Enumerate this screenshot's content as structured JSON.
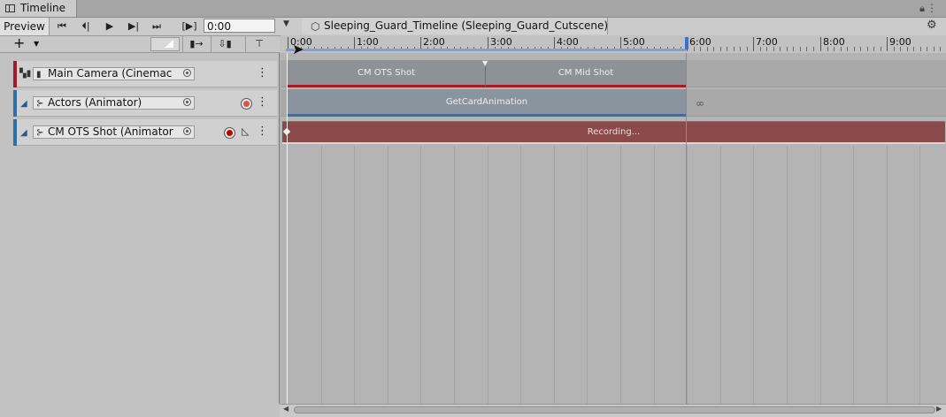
{
  "window": {
    "tab_title": "Timeline",
    "lock_icon": "lock-icon",
    "menu_icon": "vertical-ellipsis-icon"
  },
  "toolbar": {
    "preview_label": "Preview",
    "current_time": "0:00",
    "breadcrumb": "Sleeping_Guard_Timeline (Sleeping_Guard_Cutscene)",
    "buttons": [
      "go-to-start-icon",
      "previous-frame-icon",
      "play-icon",
      "next-frame-icon",
      "go-to-end-icon",
      "play-range-icon"
    ]
  },
  "ruler": {
    "labels": [
      "0:00",
      "1:00",
      "2:00",
      "3:00",
      "4:00",
      "5:00",
      "6:00",
      "7:00",
      "8:00",
      "9:00"
    ]
  },
  "tracks": [
    {
      "name": "Main Camera (Cinemac",
      "type_icon": "cinemachine-track-icon",
      "color": "#a01c2a"
    },
    {
      "name": "Actors (Animator)",
      "type_icon": "animation-track-icon",
      "color": "#2f6fa8",
      "record": "#e05050"
    },
    {
      "name": "CM OTS Shot (Animator",
      "type_icon": "animation-track-icon",
      "color": "#2f6fa8",
      "record": "#c00000"
    }
  ],
  "clips": {
    "cm_ots_shot": "CM OTS Shot",
    "cm_mid_shot": "CM Mid Shot",
    "get_card_animation": "GetCardAnimation",
    "recording": "Recording..."
  },
  "colors": {
    "cinemachine_clip": "#8e9297",
    "animation_clip": "#8a949e",
    "recording_clip": "#8b4a4a",
    "play_range": "#7f9fd8"
  }
}
